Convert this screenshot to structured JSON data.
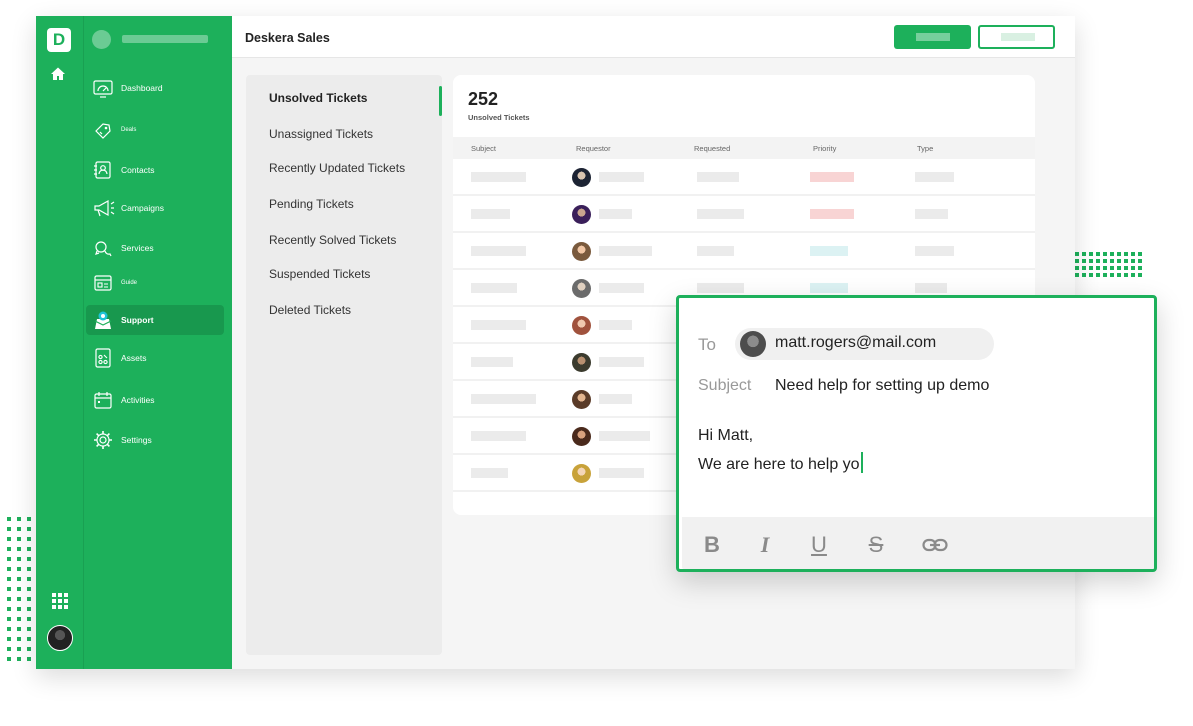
{
  "app": {
    "title": "Deskera Sales",
    "logo_letter": "D",
    "accent_color": "#1db05b"
  },
  "rail": {
    "icons": [
      "home-icon",
      "apps-grid-icon",
      "user-avatar"
    ]
  },
  "sidebar": {
    "items": [
      {
        "label": "Dashboard",
        "icon": "dashboard-icon",
        "active": false
      },
      {
        "label": "Deals",
        "icon": "deals-icon",
        "active": false
      },
      {
        "label": "Contacts",
        "icon": "contacts-icon",
        "active": false
      },
      {
        "label": "Campaigns",
        "icon": "megaphone-icon",
        "active": false
      },
      {
        "label": "Services",
        "icon": "chat-icon",
        "active": false
      },
      {
        "label": "Guide",
        "icon": "guide-icon",
        "active": false
      },
      {
        "label": "Support",
        "icon": "support-icon",
        "active": true
      },
      {
        "label": "Assets",
        "icon": "assets-icon",
        "active": false
      },
      {
        "label": "Activities",
        "icon": "calendar-icon",
        "active": false
      },
      {
        "label": "Settings",
        "icon": "gear-icon",
        "active": false
      }
    ]
  },
  "views": {
    "items": [
      {
        "label": "Unsolved Tickets",
        "active": true
      },
      {
        "label": "Unassigned Tickets",
        "active": false
      },
      {
        "label": "Recently Updated Tickets",
        "active": false
      },
      {
        "label": "Pending Tickets",
        "active": false
      },
      {
        "label": "Recently Solved Tickets",
        "active": false
      },
      {
        "label": "Suspended Tickets",
        "active": false
      },
      {
        "label": "Deleted Tickets",
        "active": false
      }
    ]
  },
  "tickets": {
    "count": "252",
    "count_label": "Unsolved Tickets",
    "columns": [
      "Subject",
      "Requestor",
      "Requested",
      "Priority",
      "Type"
    ],
    "priority_colors": {
      "high": "#f8d4d4",
      "low": "#dcf2f3",
      "none": "#ebebeb"
    }
  },
  "compose": {
    "to_label": "To",
    "to_email": "matt.rogers@mail.com",
    "subject_label": "Subject",
    "subject_value": "Need help for setting up demo",
    "body_line1": "Hi Matt,",
    "body_line2": "We are here to help yo",
    "toolbar": [
      {
        "glyph": "B",
        "icon": "bold-icon"
      },
      {
        "glyph": "I",
        "icon": "italic-icon"
      },
      {
        "glyph": "U",
        "icon": "underline-icon"
      },
      {
        "glyph": "S",
        "icon": "strikethrough-icon"
      },
      {
        "glyph": "",
        "icon": "link-icon"
      }
    ]
  }
}
